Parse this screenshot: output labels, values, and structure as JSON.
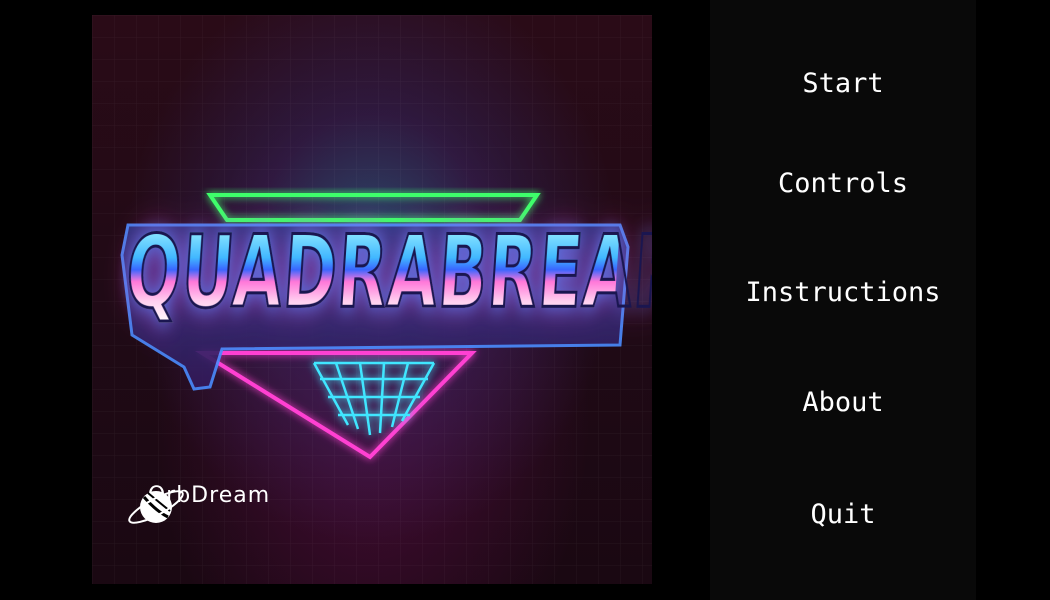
{
  "game": {
    "title": "QUADRABREAK",
    "studio": "OrbDream"
  },
  "menu": {
    "items": [
      {
        "id": "start",
        "label": "Start"
      },
      {
        "id": "controls",
        "label": "Controls"
      },
      {
        "id": "instructions",
        "label": "Instructions"
      },
      {
        "id": "about",
        "label": "About"
      },
      {
        "id": "quit",
        "label": "Quit"
      }
    ]
  },
  "colors": {
    "neon_green": "#3cff6a",
    "neon_cyan": "#3fe6ff",
    "neon_pink": "#ff3fd2",
    "menu_text": "#ffffff",
    "menu_background": "#090909"
  },
  "icons": {
    "brand_logo": "orb-planet-icon"
  }
}
